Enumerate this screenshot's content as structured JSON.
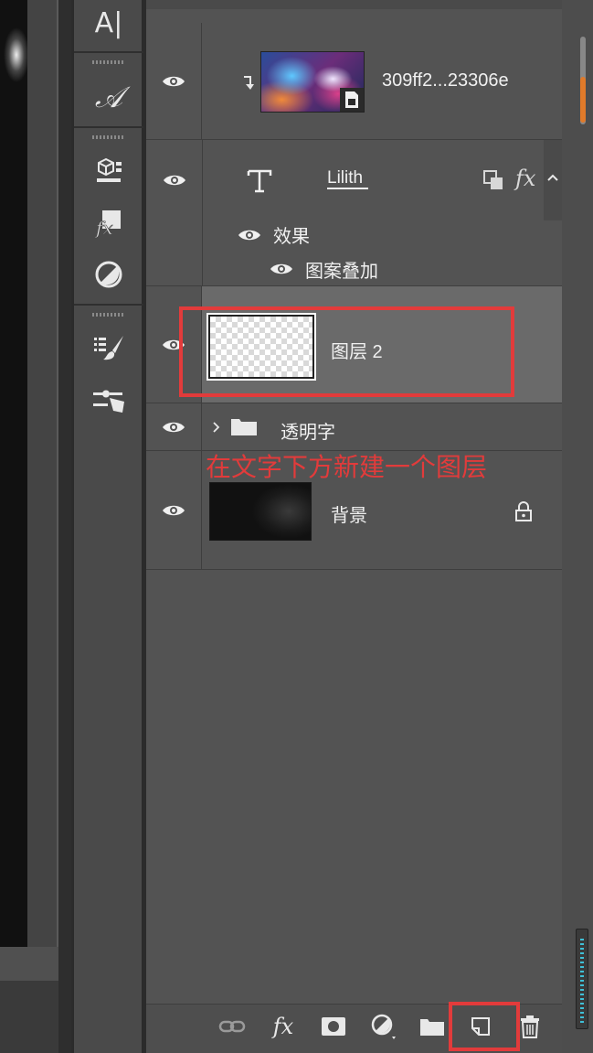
{
  "tools": {
    "type_label": "A|",
    "type_style_label": "𝒜",
    "fx_label": "fx"
  },
  "layers": [
    {
      "name": "309ff2...23306e",
      "type": "smart-object",
      "visible": true,
      "clipped": true
    },
    {
      "name": "Lilith",
      "type": "text",
      "visible": true,
      "fx_label": "fx",
      "effects_label": "效果",
      "effect_items": [
        "图案叠加"
      ]
    },
    {
      "name": "图层 2",
      "type": "pixel",
      "visible": true,
      "selected": true
    },
    {
      "name": "透明字",
      "type": "group",
      "visible": true,
      "expanded": false
    },
    {
      "name": "背景",
      "type": "background",
      "visible": true,
      "locked": true
    }
  ],
  "annotation": {
    "text": "在文字下方新建一个图层",
    "color": "#e23b3b"
  },
  "bottom_bar": {
    "fx_label": "fx"
  },
  "colors": {
    "panel_bg": "#535353",
    "selected_row": "#6a6a6a",
    "highlight_red": "#e23b3b",
    "scroll_accent": "#e07a2a"
  }
}
